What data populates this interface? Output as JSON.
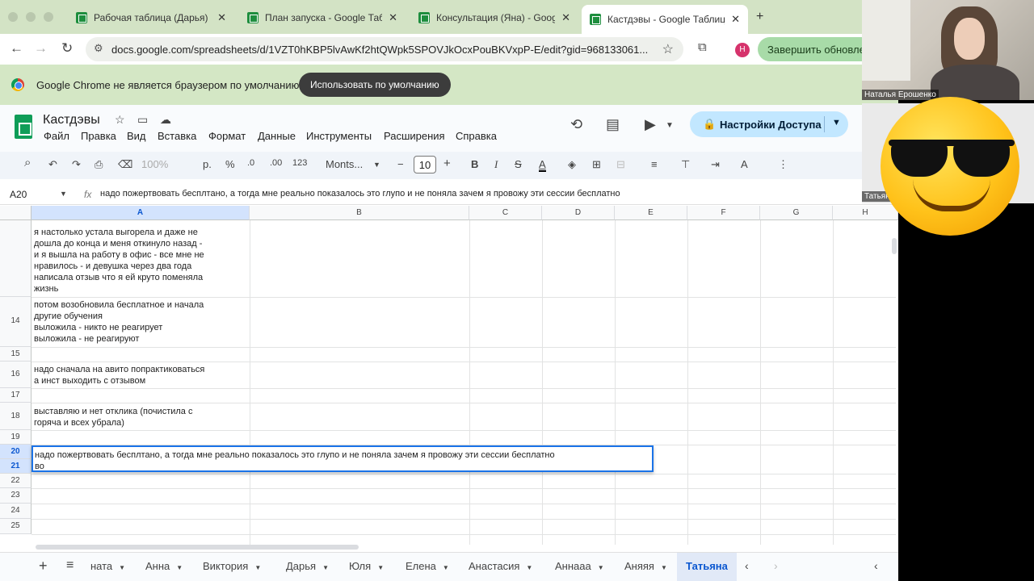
{
  "browser": {
    "tabs": [
      {
        "label": "Рабочая таблица (Дарья) - G",
        "active": false
      },
      {
        "label": "План запуска - Google Табл",
        "active": false
      },
      {
        "label": "Консультация (Яна) - Goog",
        "active": false
      },
      {
        "label": "Кастдэвы - Google Таблицы",
        "active": true
      }
    ],
    "new_tab": "+",
    "url": "docs.google.com/spreadsheets/d/1VZT0hKBP5lvAwKf2htQWpk5SPOVJkOcxPouBKVxpP-E/edit?gid=968133061...",
    "profile_initial": "Н",
    "finish_update_label": "Завершить обновлен"
  },
  "infobar": {
    "message": "Google Chrome не является браузером по умолчанию.",
    "button": "Использовать по умолчанию"
  },
  "doc": {
    "title": "Кастдэвы",
    "menus": [
      "Файл",
      "Правка",
      "Вид",
      "Вставка",
      "Формат",
      "Данные",
      "Инструменты",
      "Расширения",
      "Справка"
    ],
    "share_label": "Настройки Доступа"
  },
  "toolbar": {
    "zoom": "100%",
    "currency": "р.",
    "percent": "%",
    "dec_decrease": ".0",
    "dec_increase": ".00",
    "number_format": "123",
    "font": "Monts...",
    "font_size": "10",
    "bold": "B",
    "italic": "I",
    "text_color": "A"
  },
  "formula_bar": {
    "name_box": "A20",
    "fx": "fx",
    "content": "надо пожертвовать бесплтано, а тогда мне реально показалось это глупо и не поняла зачем я провожу эти сессии бесплатно"
  },
  "grid": {
    "columns": [
      "A",
      "B",
      "C",
      "D",
      "E",
      "F",
      "G",
      "H"
    ],
    "selected_column": "A",
    "rows": [
      {
        "num": "",
        "text": "я настолько устала выгорела и даже не\nдошла до конца и меня откинуло назад -\nи я вышла на работу в офис - все мне не\nнравилось - и девушка через два года\nнаписала отзыв что я ей круто поменяла\nжизнь"
      },
      {
        "num": "14",
        "text": "потом возобновила бесплатное и начала\nдругие обучения\nвыложила - никто не реагирует\nвыложила - не реагируют"
      },
      {
        "num": "15",
        "text": ""
      },
      {
        "num": "16",
        "text": "надо сначала на авито попрактиковаться\nа инст выходить с отзывом"
      },
      {
        "num": "17",
        "text": ""
      },
      {
        "num": "18",
        "text": "выставляю и нет отклика (почистила с\nгоряча и всех убрала)"
      },
      {
        "num": "19",
        "text": ""
      },
      {
        "num": "20",
        "text": ""
      },
      {
        "num": "21",
        "text": ""
      },
      {
        "num": "22",
        "text": ""
      },
      {
        "num": "23",
        "text": ""
      },
      {
        "num": "24",
        "text": ""
      },
      {
        "num": "25",
        "text": ""
      }
    ],
    "selected_rows": [
      "20",
      "21"
    ],
    "editing_text": "надо пожертвовать бесплтано, а тогда мне реально показалось это глупо и не поняла зачем я провожу эти сессии бесплатно\nво"
  },
  "sheets": {
    "add": "+",
    "tabs": [
      "ната",
      "Анна",
      "Виктория",
      "Дарья",
      "Юля",
      "Елена",
      "Анастасия",
      "Аннааа",
      "Аняяя",
      "Татьяна"
    ],
    "active": "Татьяна"
  },
  "video": {
    "participant_1": "Наталья Ерошенко",
    "participant_2": "Татьян"
  },
  "colors": {
    "tabbar": "#d3e3c5",
    "accent": "#1a73e8",
    "share_button": "#c2e7ff",
    "sheets_green": "#0f9d58"
  }
}
